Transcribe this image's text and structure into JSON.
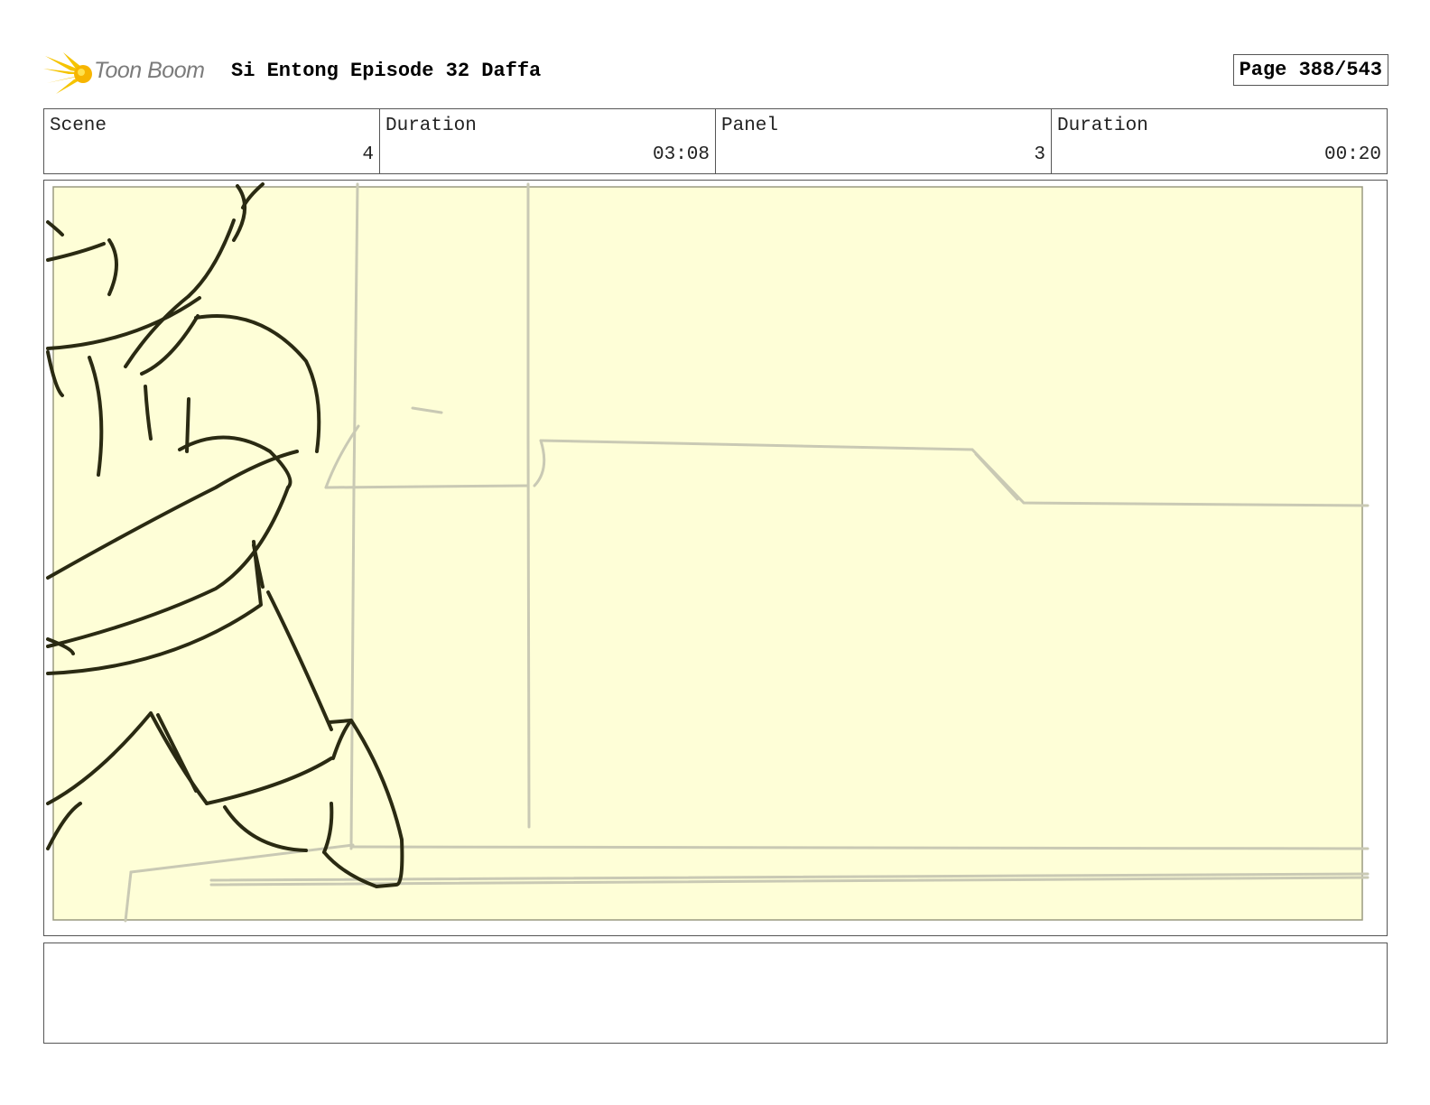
{
  "header": {
    "logo_text": "Toon Boom",
    "title": "Si Entong Episode 32 Daffa",
    "page": "Page 388/543"
  },
  "info": {
    "scene_label": "Scene",
    "scene_value": "4",
    "scene_duration_label": "Duration",
    "scene_duration_value": "03:08",
    "panel_label": "Panel",
    "panel_value": "3",
    "panel_duration_label": "Duration",
    "panel_duration_value": "00:20"
  },
  "colors": {
    "panel_bg": "#fefed7",
    "ink": "#2a2a12",
    "sketch": "#c9c9b4",
    "logo_yellow": "#f5c400"
  },
  "notes": {
    "text": ""
  }
}
